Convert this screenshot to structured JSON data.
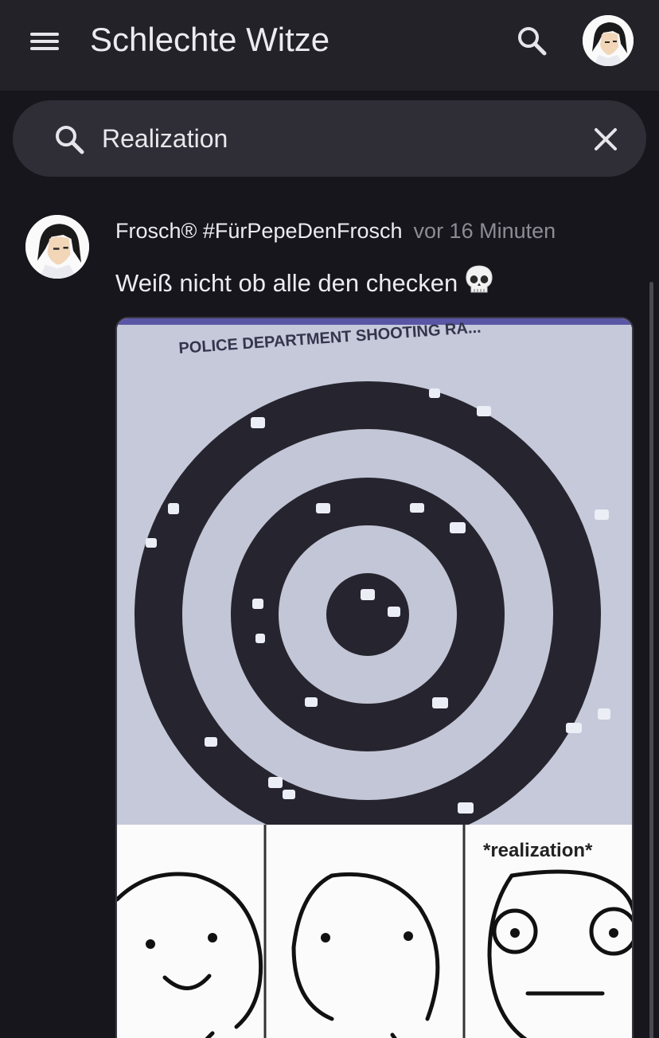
{
  "app_bar": {
    "title": "Schlechte Witze",
    "menu_icon": "hamburger-menu-icon",
    "search_icon": "search-icon",
    "avatar_icon": "user-avatar"
  },
  "search": {
    "icon": "search-icon",
    "value": "Realization",
    "clear_icon": "close-icon"
  },
  "post": {
    "author": "Frosch® #FürPepeDenFrosch",
    "time": "vor 16 Minuten",
    "text": "Weiß nicht ob alle den checken",
    "emoji_icon": "skull-icon",
    "image": {
      "target_caption": "POLICE DEPARTMENT SHOOTING RA...",
      "panel_caption": "*realization*"
    }
  },
  "colors": {
    "background": "#17161d",
    "app_bar": "#232229",
    "search_field": "#2f2e36",
    "text_primary": "#ecebf0",
    "text_secondary": "#8d8c95"
  }
}
